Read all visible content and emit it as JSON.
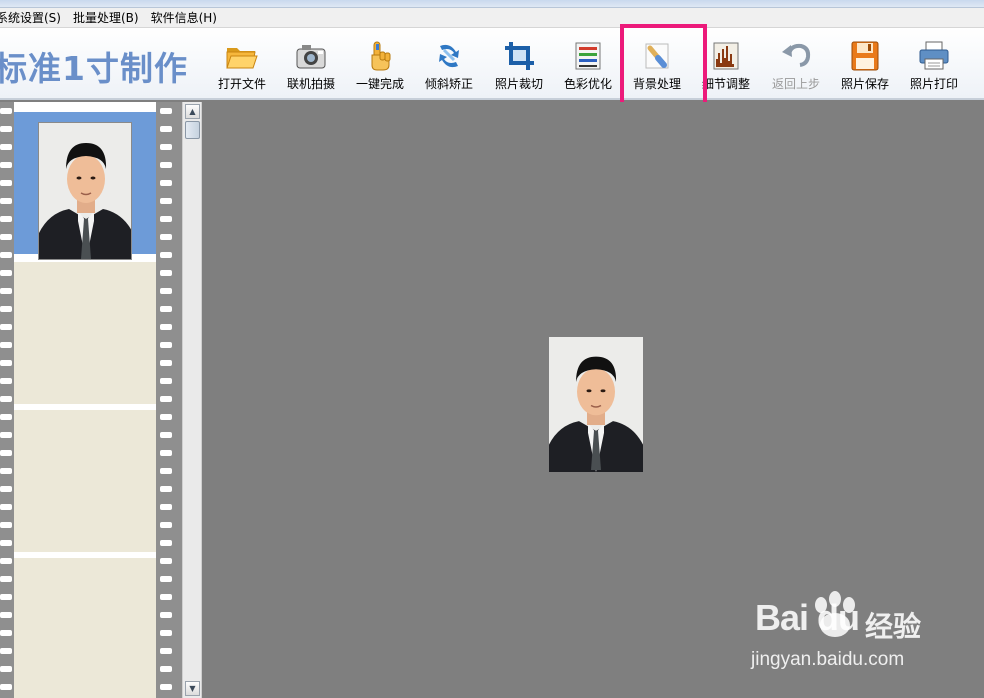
{
  "menu": {
    "items": [
      "系统设置(S)",
      "批量处理(B)",
      "软件信息(H)"
    ]
  },
  "app": {
    "title": "标准1寸制作"
  },
  "toolbar": {
    "tools": [
      {
        "label": "打开文件",
        "icon": "folder-open-icon",
        "enabled": true
      },
      {
        "label": "联机拍摄",
        "icon": "camera-icon",
        "enabled": true
      },
      {
        "label": "一键完成",
        "icon": "hand-pointer-icon",
        "enabled": true
      },
      {
        "label": "倾斜矫正",
        "icon": "rotate-arrows-icon",
        "enabled": true
      },
      {
        "label": "照片裁切",
        "icon": "crop-icon",
        "enabled": true
      },
      {
        "label": "色彩优化",
        "icon": "color-bars-icon",
        "enabled": true
      },
      {
        "label": "背景处理",
        "icon": "paint-brush-icon",
        "enabled": true,
        "highlighted": true
      },
      {
        "label": "细节调整",
        "icon": "histogram-icon",
        "enabled": true
      },
      {
        "label": "返回上步",
        "icon": "undo-arrow-icon",
        "enabled": false
      },
      {
        "label": "照片保存",
        "icon": "floppy-disk-icon",
        "enabled": true
      },
      {
        "label": "照片打印",
        "icon": "printer-icon",
        "enabled": true
      }
    ]
  },
  "colors": {
    "highlight": "#ec1a7a",
    "title": "#6a8fc9",
    "canvas": "#7f7f7f",
    "selected_frame": "#6d9bd8"
  },
  "filmstrip": {
    "frames": [
      {
        "has_photo": true,
        "selected": true
      },
      {
        "has_photo": false
      },
      {
        "has_photo": false
      },
      {
        "has_photo": false
      }
    ]
  },
  "watermark": {
    "logo": "Bai du",
    "brand": "经验",
    "url": "jingyan.baidu.com"
  }
}
